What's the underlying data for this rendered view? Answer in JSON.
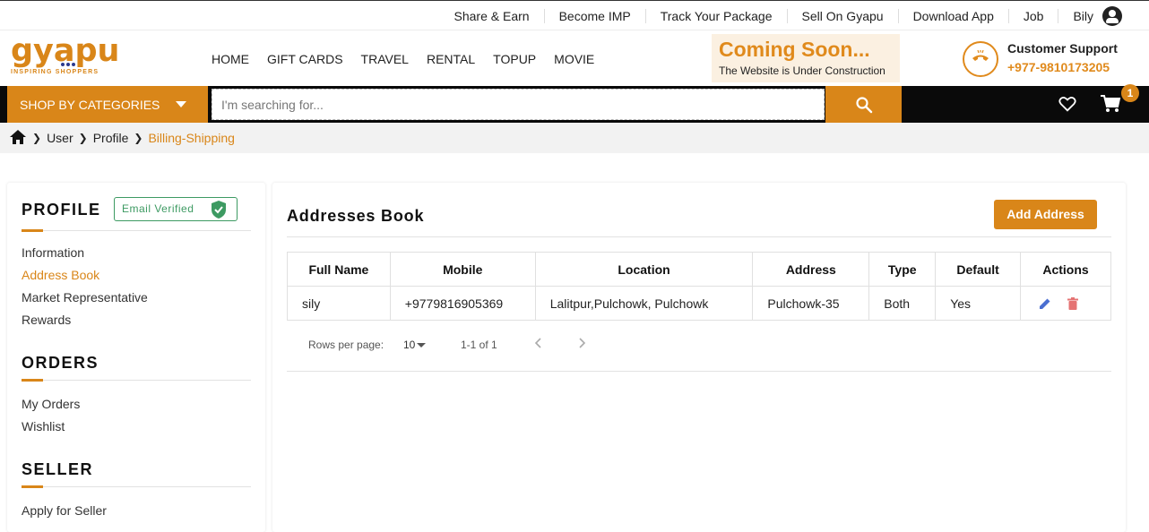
{
  "topbar": {
    "links": [
      "Share & Earn",
      "Become IMP",
      "Track Your Package",
      "Sell On Gyapu",
      "Download App",
      "Job"
    ],
    "user_name": "Bily"
  },
  "logo": {
    "word": "gyapu",
    "tagline": "INSPIRING SHOPPERS"
  },
  "nav": [
    "HOME",
    "GIFT CARDS",
    "TRAVEL",
    "RENTAL",
    "TOPUP",
    "MOVIE"
  ],
  "promo": {
    "title": "Coming Soon...",
    "subtitle": "The Website is Under Construction"
  },
  "support": {
    "title": "Customer Support",
    "phone": "+977-9810173205"
  },
  "catbar": {
    "categories_label": "SHOP BY CATEGORIES",
    "search_placeholder": "I'm searching for...",
    "cart_count": "1"
  },
  "breadcrumb": {
    "items": [
      "User",
      "Profile"
    ],
    "current": "Billing-Shipping"
  },
  "sidebar": {
    "profile_heading": "PROFILE",
    "email_status": "Email Verified",
    "profile_items": [
      "Information",
      "Address Book",
      "Market Representative",
      "Rewards"
    ],
    "active_item": "Address Book",
    "orders_heading": "ORDERS",
    "order_items": [
      "My Orders",
      "Wishlist"
    ],
    "seller_heading": "SELLER",
    "seller_items": [
      "Apply for Seller"
    ]
  },
  "main": {
    "title": "Addresses Book",
    "add_button": "Add Address",
    "table": {
      "columns": [
        "Full Name",
        "Mobile",
        "Location",
        "Address",
        "Type",
        "Default",
        "Actions"
      ],
      "rows": [
        {
          "full_name": "sily",
          "mobile": "+9779816905369",
          "location": "Lalitpur,Pulchowk, Pulchowk",
          "address": "Pulchowk-35",
          "type": "Both",
          "default": "Yes"
        }
      ]
    },
    "pager": {
      "rows_label": "Rows per page:",
      "rows_value": "10",
      "range": "1-1 of 1"
    }
  },
  "colors": {
    "accent": "#d98619",
    "verified": "#3d9a62",
    "edit": "#4a6fd1",
    "delete": "#e57373"
  }
}
